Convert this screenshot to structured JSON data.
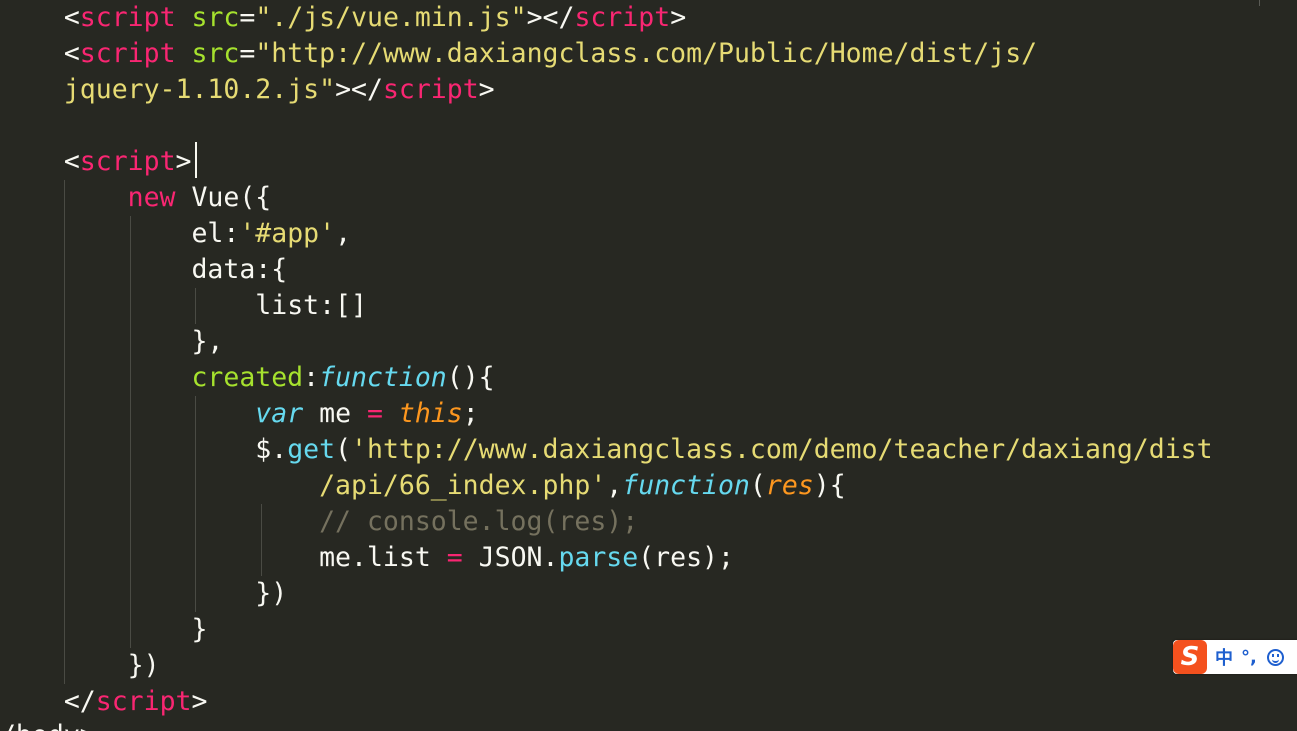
{
  "editor": {
    "theme_colors": {
      "background": "#272822",
      "text": "#f8f8f2",
      "tag": "#f92672",
      "attribute": "#a6e22e",
      "string": "#e6db74",
      "storage": "#66d9ef",
      "this": "#fd971f",
      "comment": "#75715e"
    },
    "code": {
      "l01": {
        "indent": "    ",
        "t1": "<",
        "t2": "script",
        "t3": " ",
        "t4": "src",
        "t5": "=",
        "t6": "\"./js/vue.min.js\"",
        "t7": "></",
        "t8": "script",
        "t9": ">"
      },
      "l02": {
        "indent": "    ",
        "t1": "<",
        "t2": "script",
        "t3": " ",
        "t4": "src",
        "t5": "=",
        "t6": "\"http://www.daxiangclass.com/Public/Home/dist/js/"
      },
      "l03": {
        "indent": "    ",
        "t1": "jquery-1.10.2.js\"",
        "t2": "></",
        "t3": "script",
        "t4": ">"
      },
      "l05": {
        "indent": "    ",
        "t1": "<",
        "t2": "script",
        "t3": ">"
      },
      "l06": {
        "indent": "        ",
        "t1": "new",
        "t2": " Vue({"
      },
      "l07": {
        "indent": "            ",
        "t1": "el:",
        "t2": "'#app'",
        "t3": ","
      },
      "l08": {
        "indent": "            ",
        "t1": "data:{"
      },
      "l09": {
        "indent": "                ",
        "t1": "list:[]"
      },
      "l10": {
        "indent": "            ",
        "t1": "},"
      },
      "l11": {
        "indent": "            ",
        "t1": "created",
        "t2": ":",
        "t3": "function",
        "t4": "(){"
      },
      "l12": {
        "indent": "                ",
        "t1": "var",
        "t2": " me ",
        "t3": "=",
        "t4": " ",
        "t5": "this",
        "t6": ";"
      },
      "l13": {
        "indent": "                ",
        "t1": "$.",
        "t2": "get",
        "t3": "(",
        "t4": "'http://www.daxiangclass.com/demo/teacher/daxiang/dist"
      },
      "l14": {
        "indent": "                    ",
        "t1": "/api/66_index.php'",
        "t2": ",",
        "t3": "function",
        "t4": "(",
        "t5": "res",
        "t6": "){"
      },
      "l15": {
        "indent": "                    ",
        "t1": "// console.log(res);"
      },
      "l16": {
        "indent": "                    ",
        "t1": "me.list ",
        "t2": "=",
        "t3": " JSON.",
        "t4": "parse",
        "t5": "(res);"
      },
      "l17": {
        "indent": "                ",
        "t1": "})"
      },
      "l18": {
        "indent": "            ",
        "t1": "}"
      },
      "l19": {
        "indent": "        ",
        "t1": "})"
      },
      "l20": {
        "indent": "    ",
        "t1": "</",
        "t2": "script",
        "t3": ">"
      },
      "l21": {
        "indent": "",
        "t1": "</body>"
      }
    }
  },
  "ime": {
    "logo_icon": "sogou-s-icon",
    "mode": "中",
    "punct": "°,",
    "emoji_icon": "smiley-icon",
    "accent": "#f4511e"
  }
}
